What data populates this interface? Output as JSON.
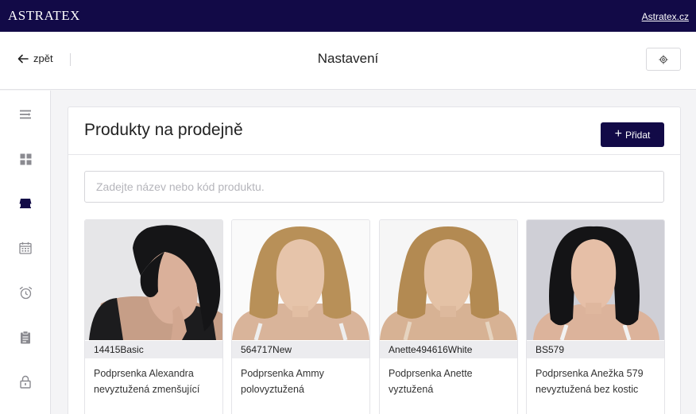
{
  "topbar": {
    "brand": "ASTRATEX",
    "link": "Astratex.cz"
  },
  "subheader": {
    "back_label": "zpět",
    "title": "Nastavení"
  },
  "sidebar": {
    "items": [
      {
        "icon": "menu-lines-icon"
      },
      {
        "icon": "grid-icon"
      },
      {
        "icon": "store-icon",
        "active": true
      },
      {
        "icon": "calendar-icon"
      },
      {
        "icon": "alarm-clock-icon"
      },
      {
        "icon": "clipboard-icon"
      },
      {
        "icon": "lock-icon"
      }
    ]
  },
  "panel": {
    "title": "Produkty na prodejně",
    "add_button": "Přidat",
    "search_placeholder": "Zadejte název nebo kód produktu."
  },
  "products": [
    {
      "code": "14415Basic",
      "name": "Podprsenka Alexandra nevyztužená zmenšující"
    },
    {
      "code": "564717New",
      "name": "Podprsenka Ammy polovyztužená"
    },
    {
      "code": "Anette494616White",
      "name": "Podprsenka Anette vyztužená"
    },
    {
      "code": "BS579",
      "name": "Podprsenka Anežka 579 nevyztužená bez kostic"
    }
  ],
  "colors": {
    "brand": "#120a47",
    "accent": "#120a47"
  }
}
